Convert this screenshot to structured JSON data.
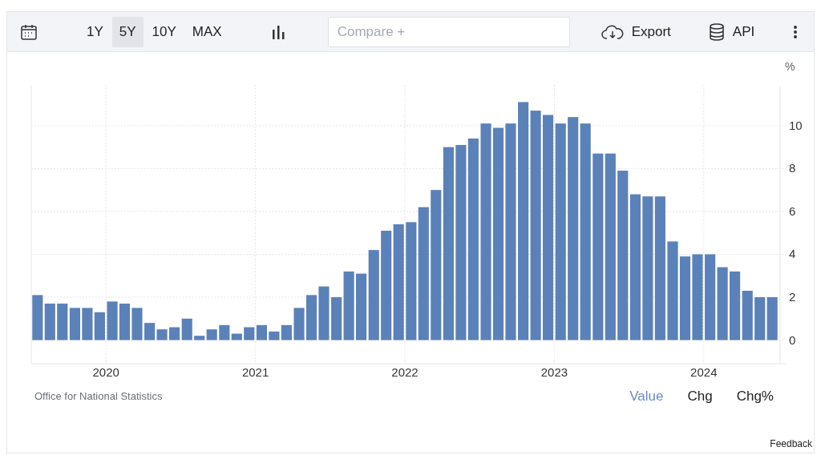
{
  "toolbar": {
    "ranges": [
      {
        "label": "1Y",
        "selected": false
      },
      {
        "label": "5Y",
        "selected": true
      },
      {
        "label": "10Y",
        "selected": false
      },
      {
        "label": "MAX",
        "selected": false
      }
    ],
    "compare": {
      "placeholder": "Compare +"
    },
    "buttons": [
      {
        "label": "Export",
        "kind": "export"
      },
      {
        "label": "API",
        "kind": "api"
      }
    ]
  },
  "chart": {
    "chart_data": {
      "type": "bar",
      "ylabel": "%",
      "grid": true,
      "x": [
        2019.542,
        2019.625,
        2019.708,
        2019.792,
        2019.875,
        2019.958,
        2020.042,
        2020.125,
        2020.208,
        2020.292,
        2020.375,
        2020.458,
        2020.542,
        2020.625,
        2020.708,
        2020.792,
        2020.875,
        2020.958,
        2021.042,
        2021.125,
        2021.208,
        2021.292,
        2021.375,
        2021.458,
        2021.542,
        2021.625,
        2021.708,
        2021.792,
        2021.875,
        2021.958,
        2022.042,
        2022.125,
        2022.208,
        2022.292,
        2022.375,
        2022.458,
        2022.542,
        2022.625,
        2022.708,
        2022.792,
        2022.875,
        2022.958,
        2023.042,
        2023.125,
        2023.208,
        2023.292,
        2023.375,
        2023.458,
        2023.542,
        2023.625,
        2023.708,
        2023.792,
        2023.875,
        2023.958,
        2024.042,
        2024.125,
        2024.208,
        2024.292,
        2024.375,
        2024.458
      ],
      "series": [
        {
          "color": "#5b81b9",
          "values": [
            2.1,
            1.7,
            1.7,
            1.5,
            1.5,
            1.3,
            1.8,
            1.7,
            1.5,
            0.8,
            0.5,
            0.6,
            1.0,
            0.2,
            0.5,
            0.7,
            0.3,
            0.6,
            0.7,
            0.4,
            0.7,
            1.5,
            2.1,
            2.5,
            2.0,
            3.2,
            3.1,
            4.2,
            5.1,
            5.4,
            5.5,
            6.2,
            7.0,
            9.0,
            9.1,
            9.4,
            10.1,
            9.9,
            10.1,
            11.1,
            10.7,
            10.5,
            10.1,
            10.4,
            10.1,
            8.7,
            8.7,
            7.9,
            6.8,
            6.7,
            6.7,
            4.6,
            3.9,
            4.0,
            4.0,
            3.4,
            3.2,
            2.3,
            2.0,
            2.0
          ]
        }
      ],
      "xlim": [
        2019.5,
        2024.5
      ],
      "ylim": [
        -1.1,
        11.9
      ],
      "yticks": [
        0,
        2,
        4,
        6,
        8,
        10
      ],
      "xticks": [
        2020,
        2021,
        2022,
        2023,
        2024
      ]
    }
  },
  "source": "Office for National Statistics",
  "views": [
    {
      "label": "Value",
      "selected": true
    },
    {
      "label": "Chg",
      "selected": false
    },
    {
      "label": "Chg%",
      "selected": false
    }
  ],
  "feedback": "Feedback"
}
